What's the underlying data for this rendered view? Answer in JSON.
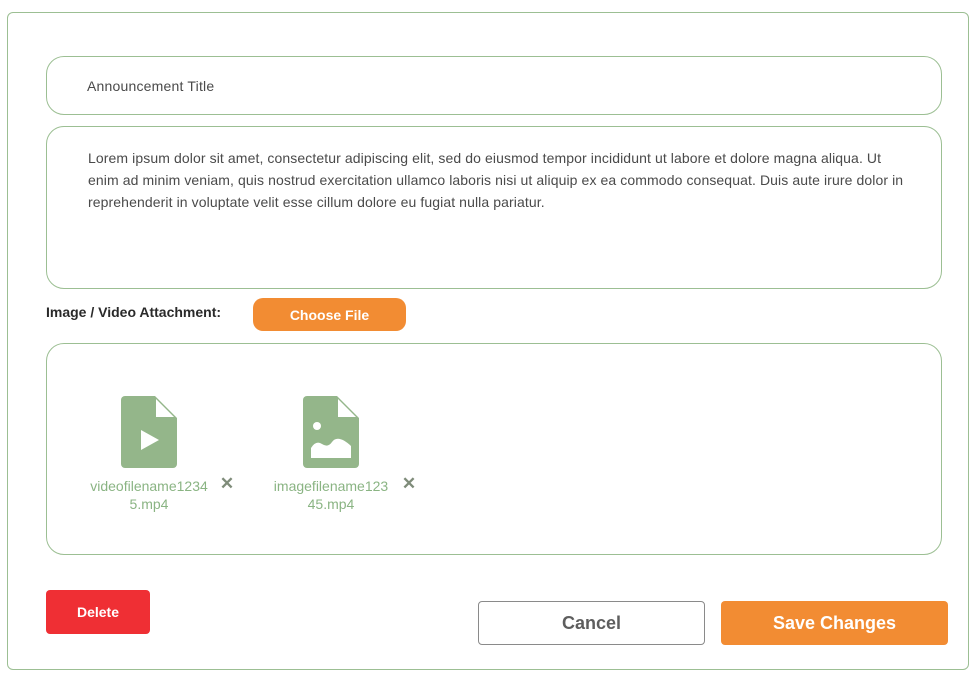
{
  "form": {
    "title_value": "Announcement Title",
    "body_value": "Lorem ipsum dolor sit amet, consectetur adipiscing elit, sed do eiusmod tempor incididunt ut labore et dolore magna aliqua. Ut enim ad minim veniam, quis nostrud exercitation ullamco laboris nisi ut aliquip ex ea commodo consequat. Duis aute irure dolor in reprehenderit in voluptate velit esse cillum dolore eu fugiat nulla pariatur."
  },
  "attachment": {
    "label": "Image / Video Attachment:",
    "choose_label": "Choose File",
    "files": [
      {
        "name": "videofilename12345.mp4",
        "icon": "video-file-icon"
      },
      {
        "name": "imagefilename12345.mp4",
        "icon": "image-file-icon"
      }
    ],
    "remove_glyph": "✕"
  },
  "actions": {
    "delete_label": "Delete",
    "cancel_label": "Cancel",
    "save_label": "Save Changes"
  },
  "colors": {
    "accent": "#f28c33",
    "danger": "#ef2f34",
    "border": "#9cbf93",
    "file_icon": "#94b68a",
    "file_text": "#8ab483"
  }
}
